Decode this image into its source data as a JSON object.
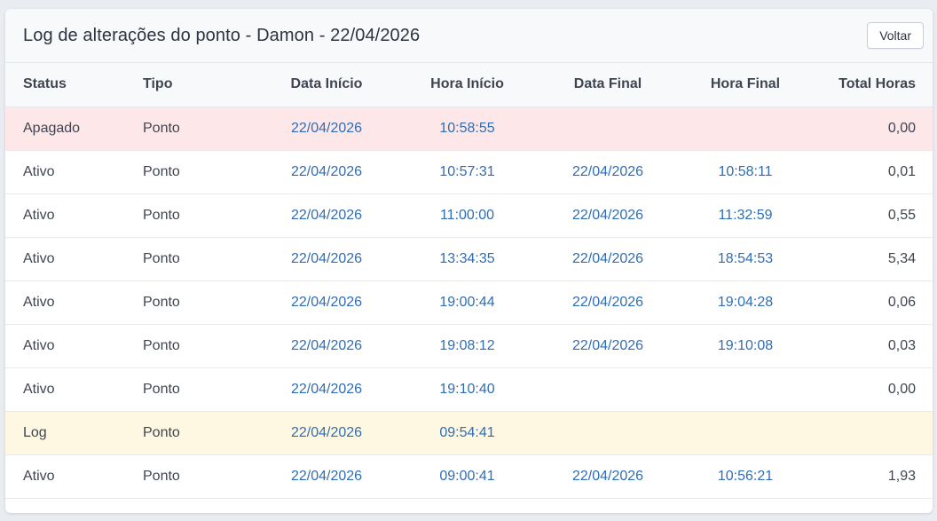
{
  "header": {
    "title": "Log de alterações do ponto - Damon - 22/04/2026",
    "back_label": "Voltar"
  },
  "table": {
    "columns": [
      "Status",
      "Tipo",
      "Data Início",
      "Hora Início",
      "Data Final",
      "Hora Final",
      "Total Horas"
    ],
    "rows": [
      {
        "status": "Apagado",
        "tipo": "Ponto",
        "data_inicio": "22/04/2026",
        "hora_inicio": "10:58:55",
        "data_final": "",
        "hora_final": "",
        "total_horas": "0,00",
        "highlight": "apagado"
      },
      {
        "status": "Ativo",
        "tipo": "Ponto",
        "data_inicio": "22/04/2026",
        "hora_inicio": "10:57:31",
        "data_final": "22/04/2026",
        "hora_final": "10:58:11",
        "total_horas": "0,01",
        "highlight": ""
      },
      {
        "status": "Ativo",
        "tipo": "Ponto",
        "data_inicio": "22/04/2026",
        "hora_inicio": "11:00:00",
        "data_final": "22/04/2026",
        "hora_final": "11:32:59",
        "total_horas": "0,55",
        "highlight": ""
      },
      {
        "status": "Ativo",
        "tipo": "Ponto",
        "data_inicio": "22/04/2026",
        "hora_inicio": "13:34:35",
        "data_final": "22/04/2026",
        "hora_final": "18:54:53",
        "total_horas": "5,34",
        "highlight": ""
      },
      {
        "status": "Ativo",
        "tipo": "Ponto",
        "data_inicio": "22/04/2026",
        "hora_inicio": "19:00:44",
        "data_final": "22/04/2026",
        "hora_final": "19:04:28",
        "total_horas": "0,06",
        "highlight": ""
      },
      {
        "status": "Ativo",
        "tipo": "Ponto",
        "data_inicio": "22/04/2026",
        "hora_inicio": "19:08:12",
        "data_final": "22/04/2026",
        "hora_final": "19:10:08",
        "total_horas": "0,03",
        "highlight": ""
      },
      {
        "status": "Ativo",
        "tipo": "Ponto",
        "data_inicio": "22/04/2026",
        "hora_inicio": "19:10:40",
        "data_final": "",
        "hora_final": "",
        "total_horas": "0,00",
        "highlight": ""
      },
      {
        "status": "Log",
        "tipo": "Ponto",
        "data_inicio": "22/04/2026",
        "hora_inicio": "09:54:41",
        "data_final": "",
        "hora_final": "",
        "total_horas": "",
        "highlight": "log"
      },
      {
        "status": "Ativo",
        "tipo": "Ponto",
        "data_inicio": "22/04/2026",
        "hora_inicio": "09:00:41",
        "data_final": "22/04/2026",
        "hora_final": "10:56:21",
        "total_horas": "1,93",
        "highlight": ""
      }
    ]
  },
  "colors": {
    "link": "#2f6db5",
    "row_apagado_bg": "#fde7e9",
    "row_log_bg": "#fef8e2",
    "header_bg": "#f8f9fb"
  }
}
